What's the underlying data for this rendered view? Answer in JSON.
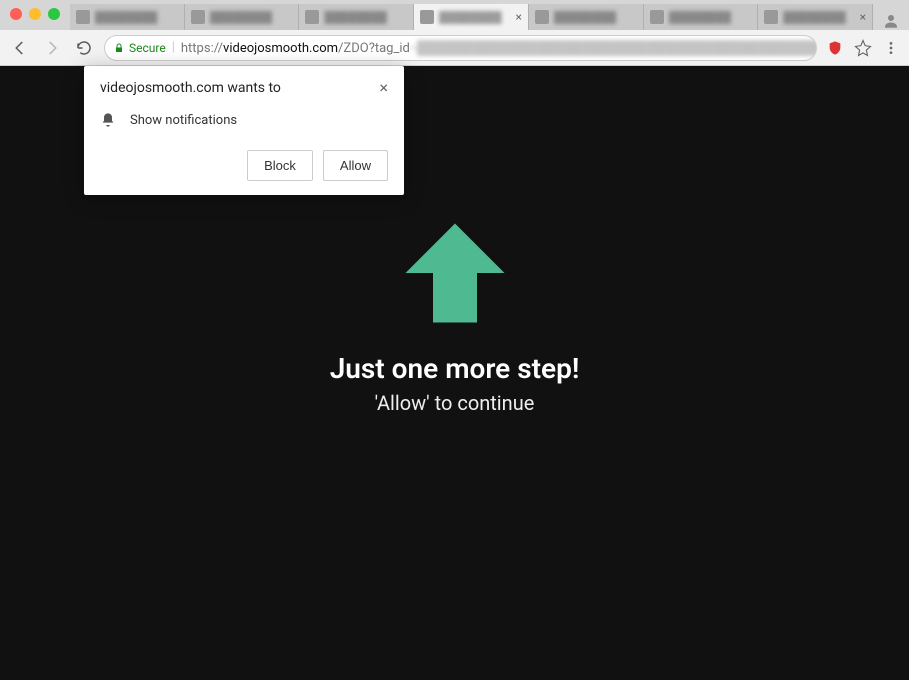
{
  "tabs": {
    "items": [
      {
        "label": "████████"
      },
      {
        "label": "████████"
      },
      {
        "label": "████████"
      },
      {
        "label": "████████"
      },
      {
        "label": "████████"
      },
      {
        "label": "████████"
      },
      {
        "label": "████████"
      }
    ],
    "active_index": 3
  },
  "address_bar": {
    "secure_label": "Secure",
    "scheme": "https://",
    "host": "videojosmooth.com",
    "path": "/ZDO?tag_id"
  },
  "permission_prompt": {
    "title": "videojosmooth.com wants to",
    "permission_label": "Show notifications",
    "block_label": "Block",
    "allow_label": "Allow"
  },
  "page_content": {
    "headline": "Just one more step!",
    "subline": "'Allow' to continue",
    "arrow_color": "#4fb991"
  }
}
